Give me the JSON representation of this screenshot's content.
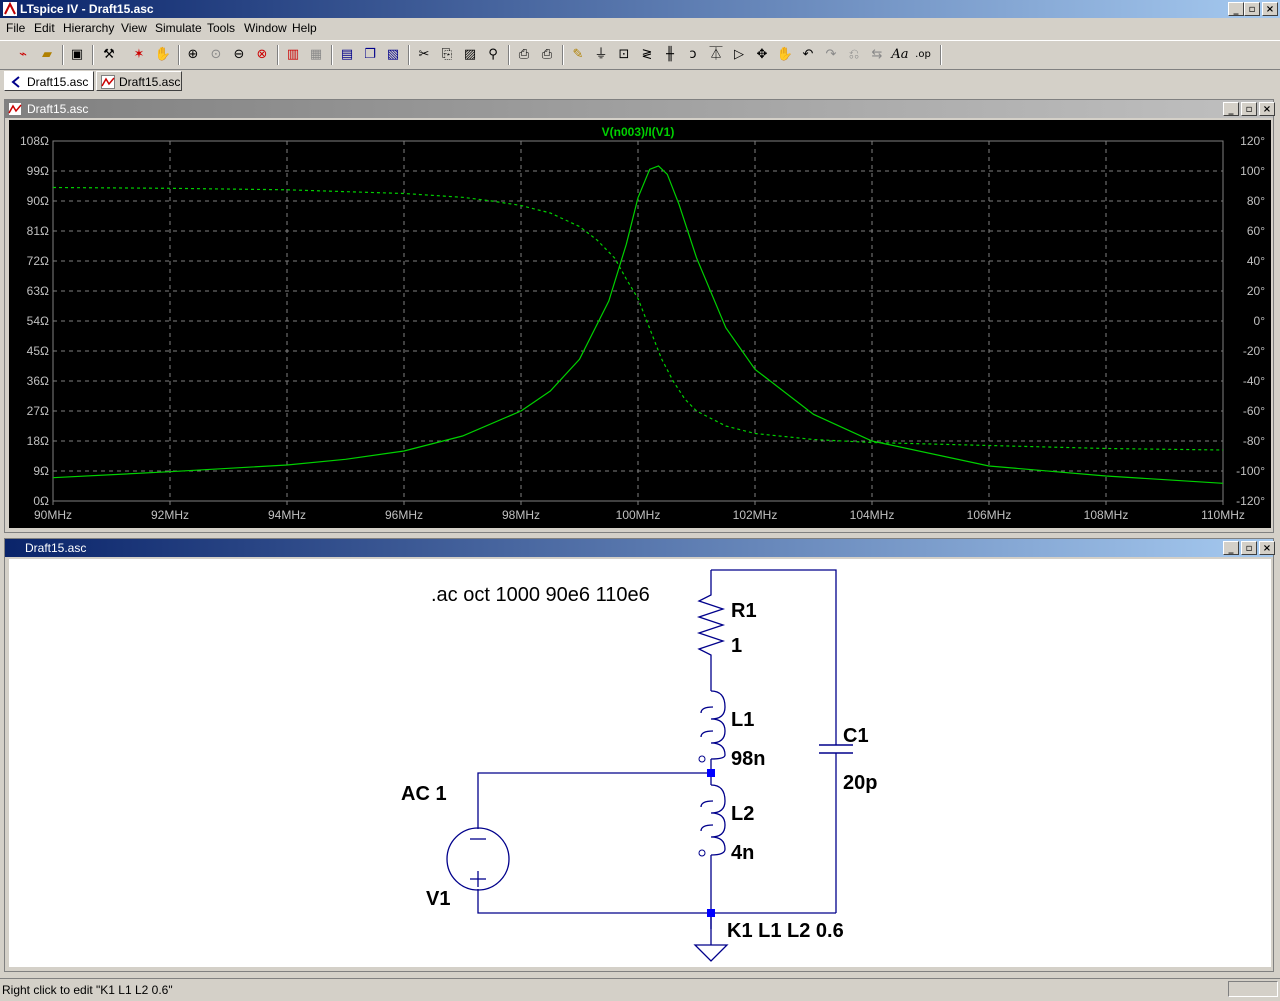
{
  "app": {
    "title": "LTspice IV - Draft15.asc"
  },
  "menu": [
    "File",
    "Edit",
    "Hierarchy",
    "View",
    "Simulate",
    "Tools",
    "Window",
    "Help"
  ],
  "tabs": [
    {
      "label": "Draft15.asc"
    },
    {
      "label": "Draft15.asc"
    }
  ],
  "plot_window": {
    "title": "Draft15.asc"
  },
  "schematic_window": {
    "title": "Draft15.asc"
  },
  "status": {
    "text": "Right click to edit \"K1 L1 L2 0.6\""
  },
  "colors": {
    "trace": "#00d000",
    "grid": "#808080",
    "wire": "#00008b",
    "plot_bg": "#000000"
  },
  "chart_data": {
    "type": "line",
    "title": "V(n003)/I(V1)",
    "xlabel": "",
    "ylabel": "",
    "xlim": [
      90,
      110
    ],
    "ylim": [
      0,
      108
    ],
    "y2lim": [
      -120,
      120
    ],
    "x_ticks": [
      "90MHz",
      "92MHz",
      "94MHz",
      "96MHz",
      "98MHz",
      "100MHz",
      "102MHz",
      "104MHz",
      "106MHz",
      "108MHz",
      "110MHz"
    ],
    "y_ticks": [
      "108Ω",
      "99Ω",
      "90Ω",
      "81Ω",
      "72Ω",
      "63Ω",
      "54Ω",
      "45Ω",
      "36Ω",
      "27Ω",
      "18Ω",
      "9Ω",
      "0Ω"
    ],
    "y2_ticks": [
      "120°",
      "100°",
      "80°",
      "60°",
      "40°",
      "20°",
      "0°",
      "-20°",
      "-40°",
      "-60°",
      "-80°",
      "-100°",
      "-120°"
    ],
    "grid": true,
    "series": [
      {
        "name": "magnitude",
        "axis": "left",
        "style": "solid",
        "x": [
          90,
          92,
          94,
          95,
          96,
          97,
          98,
          98.5,
          99,
          99.5,
          99.8,
          100,
          100.2,
          100.35,
          100.5,
          100.7,
          101,
          101.5,
          102,
          103,
          104,
          106,
          108,
          110
        ],
        "y": [
          7,
          8.8,
          10.8,
          12.5,
          15,
          19.5,
          27,
          33,
          42.5,
          60,
          77,
          91,
          99.5,
          100.5,
          98,
          89,
          73,
          52,
          39.5,
          26,
          18,
          10.5,
          7.5,
          5.3
        ]
      },
      {
        "name": "phase",
        "axis": "right",
        "style": "dashed",
        "x": [
          90,
          92,
          94,
          96,
          97,
          97.5,
          98,
          98.5,
          99,
          99.3,
          99.6,
          99.8,
          100,
          100.2,
          100.4,
          100.6,
          100.8,
          101,
          101.5,
          102,
          103,
          104,
          106,
          108,
          110
        ],
        "y": [
          89,
          88.5,
          87.5,
          85,
          82.5,
          80,
          77,
          72,
          63,
          54,
          42,
          28,
          15,
          -5,
          -25,
          -40,
          -52,
          -60,
          -70,
          -75,
          -79,
          -81,
          -83,
          -85,
          -86
        ]
      }
    ]
  },
  "schematic": {
    "directive": ".ac oct 1000 90e6 110e6",
    "labels": [
      {
        "id": "r1-name",
        "text": "R1"
      },
      {
        "id": "r1-value",
        "text": "1"
      },
      {
        "id": "l1-name",
        "text": "L1"
      },
      {
        "id": "l1-value",
        "text": "98n"
      },
      {
        "id": "l2-name",
        "text": "L2"
      },
      {
        "id": "l2-value",
        "text": "4n"
      },
      {
        "id": "c1-name",
        "text": "C1"
      },
      {
        "id": "c1-value",
        "text": "20p"
      },
      {
        "id": "v1-value",
        "text": "AC 1"
      },
      {
        "id": "v1-name",
        "text": "V1"
      },
      {
        "id": "coupling",
        "text": "K1 L1 L2 0.6"
      }
    ]
  }
}
